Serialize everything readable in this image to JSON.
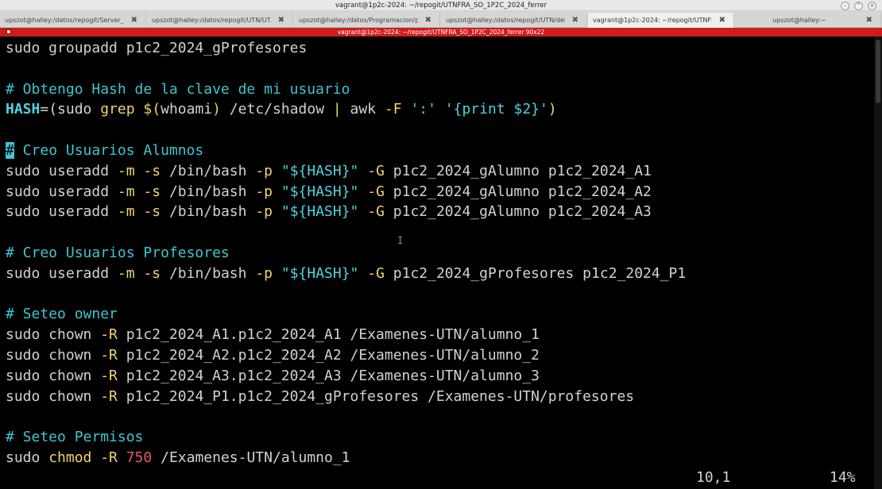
{
  "window": {
    "title": "vagrant@1p2c-2024: ~/repogit/UTNFRA_SO_1P2C_2024_ferrer",
    "controls": [
      "minimize",
      "maximize",
      "close"
    ]
  },
  "tabs": [
    {
      "label": "upszot@halley:/datos/repogit/Server_...",
      "active": false
    },
    {
      "label": "upszot@halley:/datos/repogit/UTN/UT...",
      "active": false
    },
    {
      "label": "upszot@halley:/datos/Programacion/py...",
      "active": false
    },
    {
      "label": "upszot@halley:/datos/repogit/UTN/def...",
      "active": false
    },
    {
      "label": "vagrant@1p2c-2024: ~/repogit/UTNFR...",
      "active": true
    },
    {
      "label": "upszot@halley:~",
      "active": false
    }
  ],
  "terminal_header": "vagrant@1p2c-2024: ~/repogit/UTNFRA_SO_1P2C_2024_ferrer 90x22",
  "lines": [
    "sudo groupadd p1c2_2024_gProfesores",
    "",
    "# Obtengo Hash de la clave de mi usuario",
    "HASH=$(sudo grep $(whoami) /etc/shadow | awk -F ':' '{print $2}')",
    "",
    "# Creo Usuarios Alumnos",
    "sudo useradd -m -s /bin/bash -p \"${HASH}\" -G p1c2_2024_gAlumno p1c2_2024_A1",
    "sudo useradd -m -s /bin/bash -p \"${HASH}\" -G p1c2_2024_gAlumno p1c2_2024_A2",
    "sudo useradd -m -s /bin/bash -p \"${HASH}\" -G p1c2_2024_gAlumno p1c2_2024_A3",
    "",
    "# Creo Usuarios Profesores",
    "sudo useradd -m -s /bin/bash -p \"${HASH}\" -G p1c2_2024_gProfesores p1c2_2024_P1",
    "",
    "# Seteo owner",
    "sudo chown -R p1c2_2024_A1.p1c2_2024_A1 /Examenes-UTN/alumno_1",
    "sudo chown -R p1c2_2024_A2.p1c2_2024_A2 /Examenes-UTN/alumno_2",
    "sudo chown -R p1c2_2024_A3.p1c2_2024_A3 /Examenes-UTN/alumno_3",
    "sudo chown -R p1c2_2024_P1.p1c2_2024_gProfesores /Examenes-UTN/profesores",
    "",
    "# Seteo Permisos",
    "sudo chmod -R 750 /Examenes-UTN/alumno_1"
  ],
  "status": {
    "position": "10,1",
    "percent": "14%"
  },
  "colors": {
    "comment": "#3fc5d0",
    "keyword": "#f3d270",
    "number": "#e15b5b",
    "header_bg": "#cf1d1d"
  }
}
